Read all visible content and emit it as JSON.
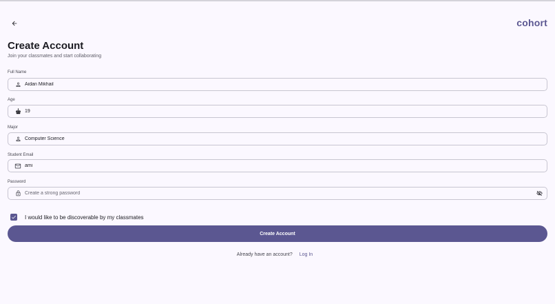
{
  "header": {
    "brand": "cohort"
  },
  "page": {
    "title": "Create Account",
    "subtitle": "Join your classmates and start collaborating"
  },
  "form": {
    "full_name": {
      "label": "Full Name",
      "value": "Aidan Mikhail",
      "icon": "person-icon"
    },
    "age": {
      "label": "Age",
      "value": "19",
      "icon": "cake-icon"
    },
    "major": {
      "label": "Major",
      "value": "Computer Science",
      "icon": "person-icon"
    },
    "email": {
      "label": "Student Email",
      "value": "ami",
      "icon": "mail-icon"
    },
    "password": {
      "label": "Password",
      "value": "",
      "placeholder": "Create a strong password",
      "icon": "lock-icon",
      "toggle_icon": "eye-off-icon"
    },
    "discoverable": {
      "label": "I would like to be discoverable by my classmates",
      "checked": true
    }
  },
  "actions": {
    "submit_label": "Create Account",
    "login_prompt": "Already have an account?",
    "login_label": "Log In"
  },
  "colors": {
    "primary": "#5B5791",
    "background": "#FBF8FF",
    "outline": "#C7C5D0",
    "text": "#1B1B21"
  }
}
